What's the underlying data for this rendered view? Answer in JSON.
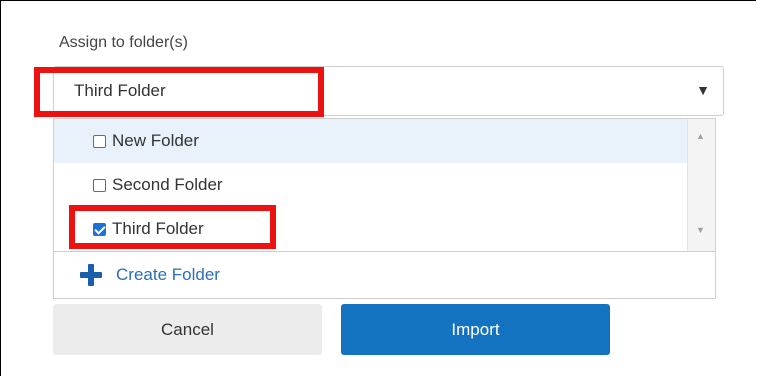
{
  "field": {
    "label": "Assign to folder(s)",
    "selected_value": "Third Folder",
    "caret_icon": "▼"
  },
  "folders": [
    {
      "label": "New Folder",
      "checked": false
    },
    {
      "label": "Second Folder",
      "checked": false
    },
    {
      "label": "Third Folder",
      "checked": true
    }
  ],
  "scrollbar": {
    "up_icon": "▲",
    "down_icon": "▼"
  },
  "create_folder": {
    "label": "Create Folder",
    "icon": "plus-icon"
  },
  "buttons": {
    "cancel": "Cancel",
    "import": "Import"
  },
  "colors": {
    "highlight": "#ee1111",
    "primary": "#1473c0",
    "link": "#2a6fb8",
    "checkbox_checked": "#1a73d4",
    "hover_row": "#e9f2fb"
  }
}
